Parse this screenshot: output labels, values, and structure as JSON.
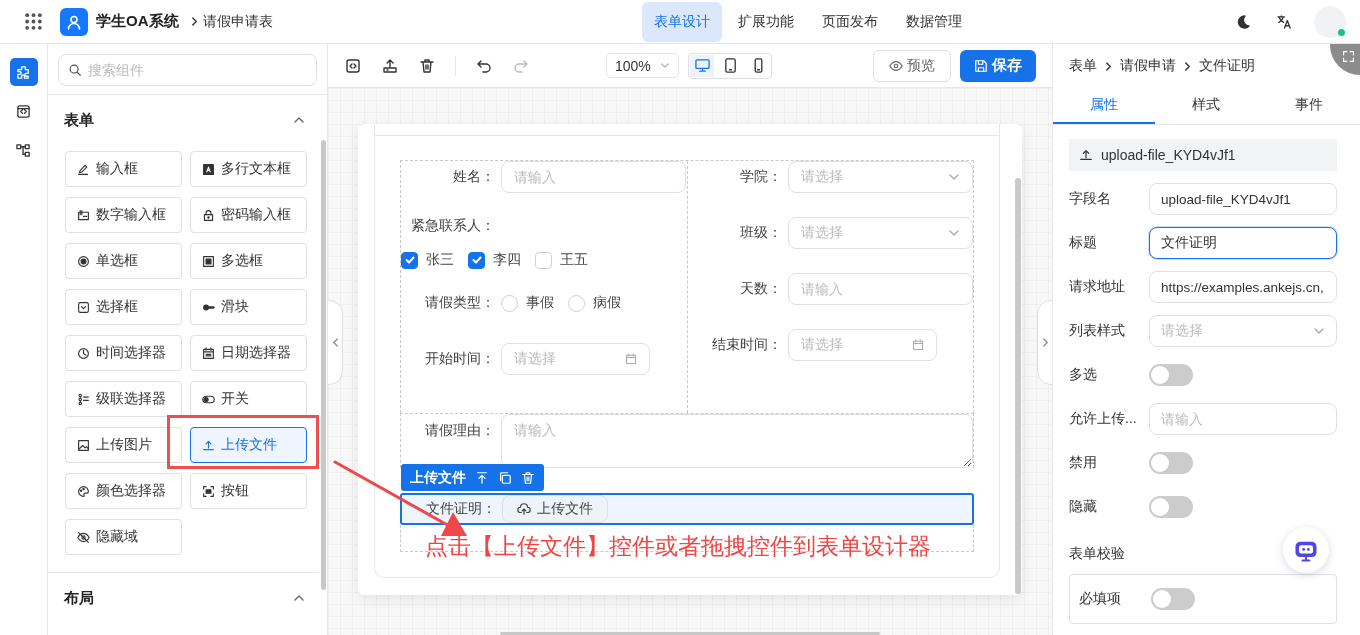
{
  "header": {
    "app_name": "学生OA系统",
    "page_title": "请假申请表",
    "nav": [
      {
        "label": "表单设计",
        "selected": true
      },
      {
        "label": "扩展功能",
        "selected": false
      },
      {
        "label": "页面发布",
        "selected": false
      },
      {
        "label": "数据管理",
        "selected": false
      }
    ],
    "user_online": true
  },
  "rail": [
    {
      "kind": "components",
      "selected": true
    },
    {
      "kind": "code",
      "selected": false
    },
    {
      "kind": "tree",
      "selected": false
    }
  ],
  "components_panel": {
    "search_placeholder": "搜索组件",
    "groups": [
      {
        "title": "表单",
        "expanded": true,
        "items": [
          {
            "label": "输入框",
            "kind": "pencil",
            "selected": false,
            "highlighted": false
          },
          {
            "label": "多行文本框",
            "kind": "textarea",
            "selected": false,
            "highlighted": false
          },
          {
            "label": "数字输入框",
            "kind": "number",
            "selected": false,
            "highlighted": false
          },
          {
            "label": "密码输入框",
            "kind": "lock",
            "selected": false,
            "highlighted": false
          },
          {
            "label": "单选框",
            "kind": "radio",
            "selected": false,
            "highlighted": false
          },
          {
            "label": "多选框",
            "kind": "checkbox",
            "selected": false,
            "highlighted": false
          },
          {
            "label": "选择框",
            "kind": "select",
            "selected": false,
            "highlighted": false
          },
          {
            "label": "滑块",
            "kind": "slider",
            "selected": false,
            "highlighted": false
          },
          {
            "label": "时间选择器",
            "kind": "clock",
            "selected": false,
            "highlighted": false
          },
          {
            "label": "日期选择器",
            "kind": "calendar",
            "selected": false,
            "highlighted": false
          },
          {
            "label": "级联选择器",
            "kind": "cascade",
            "selected": false,
            "highlighted": false
          },
          {
            "label": "开关",
            "kind": "toggle",
            "selected": false,
            "highlighted": false
          },
          {
            "label": "上传图片",
            "kind": "image",
            "selected": false,
            "highlighted": false
          },
          {
            "label": "上传文件",
            "kind": "upload",
            "selected": true,
            "highlighted": true
          },
          {
            "label": "颜色选择器",
            "kind": "palette",
            "selected": false,
            "highlighted": false
          },
          {
            "label": "按钮",
            "kind": "frame",
            "selected": false,
            "highlighted": false
          },
          {
            "label": "隐藏域",
            "kind": "eyeoff",
            "selected": false,
            "highlighted": false
          }
        ]
      },
      {
        "title": "布局",
        "expanded": true
      }
    ]
  },
  "toolbar": {
    "zoom": "100%",
    "devices": [
      {
        "kind": "desktop",
        "selected": true
      },
      {
        "kind": "tablet",
        "selected": false
      },
      {
        "kind": "phone",
        "selected": false
      }
    ],
    "preview": "预览",
    "save": "保存"
  },
  "form": {
    "columns": [
      [
        {
          "kind": "input",
          "label": "姓名：",
          "placeholder": "请输入"
        },
        {
          "kind": "checkboxes",
          "label": "紧急联系人：",
          "options": [
            {
              "label": "张三",
              "checked": true
            },
            {
              "label": "李四",
              "checked": true
            },
            {
              "label": "王五",
              "checked": false
            }
          ]
        },
        {
          "kind": "radios",
          "label": "请假类型：",
          "options": [
            {
              "label": "事假",
              "selected": false
            },
            {
              "label": "病假",
              "selected": false
            }
          ]
        },
        {
          "kind": "date",
          "label": "开始时间：",
          "placeholder": "请选择"
        }
      ],
      [
        {
          "kind": "select",
          "label": "学院：",
          "placeholder": "请选择"
        },
        {
          "kind": "select",
          "label": "班级：",
          "placeholder": "请选择"
        },
        {
          "kind": "input",
          "label": "天数：",
          "placeholder": "请输入"
        },
        {
          "kind": "date",
          "label": "结束时间：",
          "placeholder": "请选择"
        }
      ]
    ],
    "full": [
      {
        "kind": "textarea",
        "label": "请假理由：",
        "placeholder": "请输入",
        "selected": false
      },
      {
        "kind": "upload",
        "label": "文件证明：",
        "button": "上传文件",
        "selected": true,
        "tag": "上传文件"
      }
    ]
  },
  "annotation": {
    "text": "点击【上传文件】控件或者拖拽控件到表单设计器"
  },
  "properties": {
    "breadcrumb": [
      "表单",
      "请假申请",
      "文件证明"
    ],
    "tabs": [
      {
        "label": "属性",
        "selected": true
      },
      {
        "label": "样式",
        "selected": false
      },
      {
        "label": "事件",
        "selected": false
      }
    ],
    "component": "upload-file_KYD4vJf1",
    "rows": [
      {
        "kind": "input",
        "label": "字段名",
        "value": "upload-file_KYD4vJf1",
        "focused": false
      },
      {
        "kind": "input",
        "label": "标题",
        "value": "文件证明",
        "focused": true
      },
      {
        "kind": "input",
        "label": "请求地址",
        "value": "https://examples.ankejs.cn,",
        "focused": false
      },
      {
        "kind": "select",
        "label": "列表样式",
        "placeholder": "请选择"
      },
      {
        "kind": "switch",
        "label": "多选",
        "on": false
      },
      {
        "kind": "input",
        "label": "允许上传...",
        "placeholder": "请输入",
        "focused": false
      },
      {
        "kind": "switch",
        "label": "禁用",
        "on": false
      },
      {
        "kind": "switch",
        "label": "隐藏",
        "on": false
      }
    ],
    "validation": {
      "title": "表单校验",
      "rows": [
        {
          "label": "必填项",
          "on": false
        }
      ]
    }
  }
}
